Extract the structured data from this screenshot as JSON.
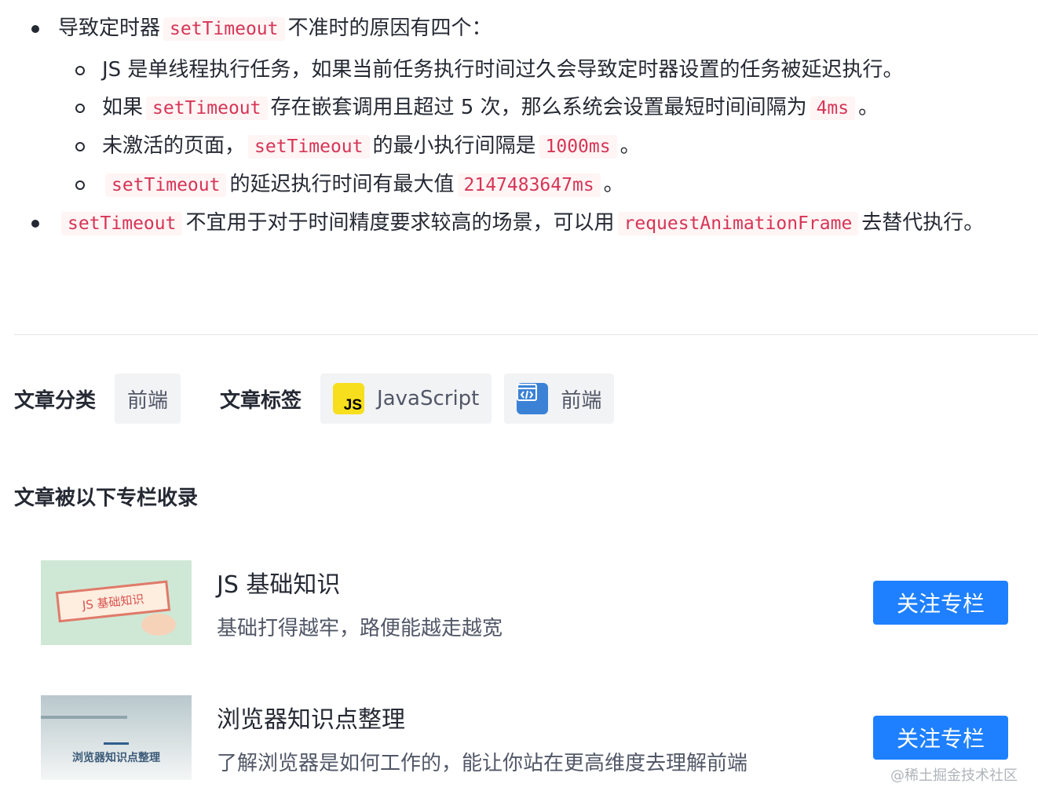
{
  "list": {
    "item1": {
      "pre": "导致定时器",
      "code": "setTimeout",
      "post": "不准时的原因有四个："
    },
    "subitems": {
      "s1": {
        "text": "JS 是单线程执行任务，如果当前任务执行时间过久会导致定时器设置的任务被延迟执行。"
      },
      "s2": {
        "pre": "如果",
        "code1": "setTimeout",
        "mid": "存在嵌套调用且超过 5 次，那么系统会设置最短时间间隔为",
        "code2": "4ms",
        "post": "。"
      },
      "s3": {
        "pre": "未激活的页面，",
        "code1": "setTimeout",
        "mid": "的最小执行间隔是",
        "code2": "1000ms",
        "post": "。"
      },
      "s4": {
        "code1": "setTimeout",
        "mid": "的延迟执行时间有最大值",
        "code2": "2147483647ms",
        "post": "。"
      }
    },
    "item2": {
      "code1": "setTimeout",
      "mid": "不宜用于对于时间精度要求较高的场景，可以用",
      "code2": "requestAnimationFrame",
      "post": "去替代执行。"
    }
  },
  "meta": {
    "category_label": "文章分类",
    "category": "前端",
    "tags_label": "文章标签",
    "tags": [
      {
        "label": "JavaScript",
        "icon": "javascript-icon"
      },
      {
        "label": "前端",
        "icon": "web-code-icon"
      }
    ]
  },
  "columns_title": "文章被以下专栏收录",
  "columns": [
    {
      "title": "JS 基础知识",
      "desc": "基础打得越牢，路便能越走越宽",
      "button": "关注专栏",
      "thumb_text": "JS 基础知识",
      "thumb_bg": "#cfe8d6"
    },
    {
      "title": "浏览器知识点整理",
      "desc": "了解浏览器是如何工作的，能让你站在更高维度去理解前端",
      "button": "关注专栏",
      "thumb_text": "浏览器知识点整理",
      "thumb_bg": "#e9eef0"
    }
  ],
  "watermark": "@稀土掘金技术社区",
  "colors": {
    "accent": "#1e80ff",
    "code_text": "#d63556",
    "code_bg": "#fff5f5"
  }
}
